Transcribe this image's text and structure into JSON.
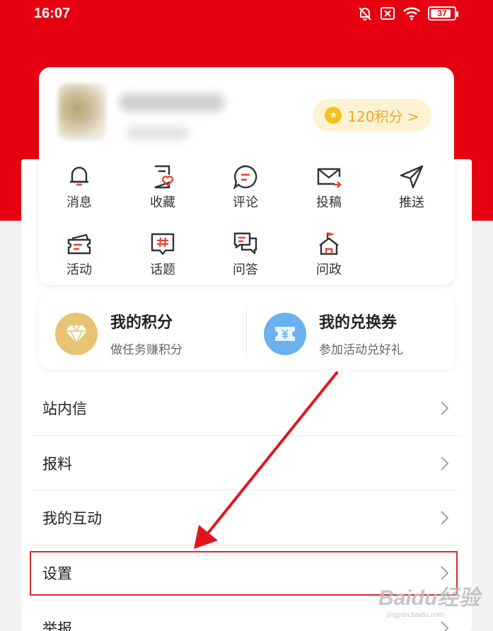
{
  "status_bar": {
    "time": "16:07",
    "battery": "37"
  },
  "profile": {
    "points_label": "120积分 >"
  },
  "quick_actions": [
    {
      "label": "消息",
      "icon": "bell-icon"
    },
    {
      "label": "收藏",
      "icon": "favorite-doc-icon"
    },
    {
      "label": "评论",
      "icon": "comment-icon"
    },
    {
      "label": "投稿",
      "icon": "mail-send-icon"
    },
    {
      "label": "推送",
      "icon": "paper-plane-icon"
    },
    {
      "label": "活动",
      "icon": "ticket-icon"
    },
    {
      "label": "话题",
      "icon": "hashtag-icon"
    },
    {
      "label": "问答",
      "icon": "qa-icon"
    },
    {
      "label": "问政",
      "icon": "government-building-icon"
    }
  ],
  "stats": {
    "points": {
      "title": "我的积分",
      "subtitle": "做任务赚积分",
      "icon": "diamond-icon",
      "color": "#e8c374"
    },
    "coupons": {
      "title": "我的兑换券",
      "subtitle": "参加活动兑好礼",
      "icon": "coupon-icon",
      "color": "#6ab1ee"
    }
  },
  "menu": [
    {
      "label": "站内信"
    },
    {
      "label": "报料"
    },
    {
      "label": "我的互动"
    },
    {
      "label": "设置"
    },
    {
      "label": "举报"
    }
  ],
  "annotation": {
    "highlight_color": "#d9282f",
    "arrow_color": "#e0161e"
  },
  "watermark": {
    "brand": "Baidu经验",
    "url": "jingyan.baidu.com"
  },
  "colors": {
    "brand_red": "#e60012",
    "accent_icon_red": "#e8432d",
    "points_text": "#e9a62a"
  }
}
